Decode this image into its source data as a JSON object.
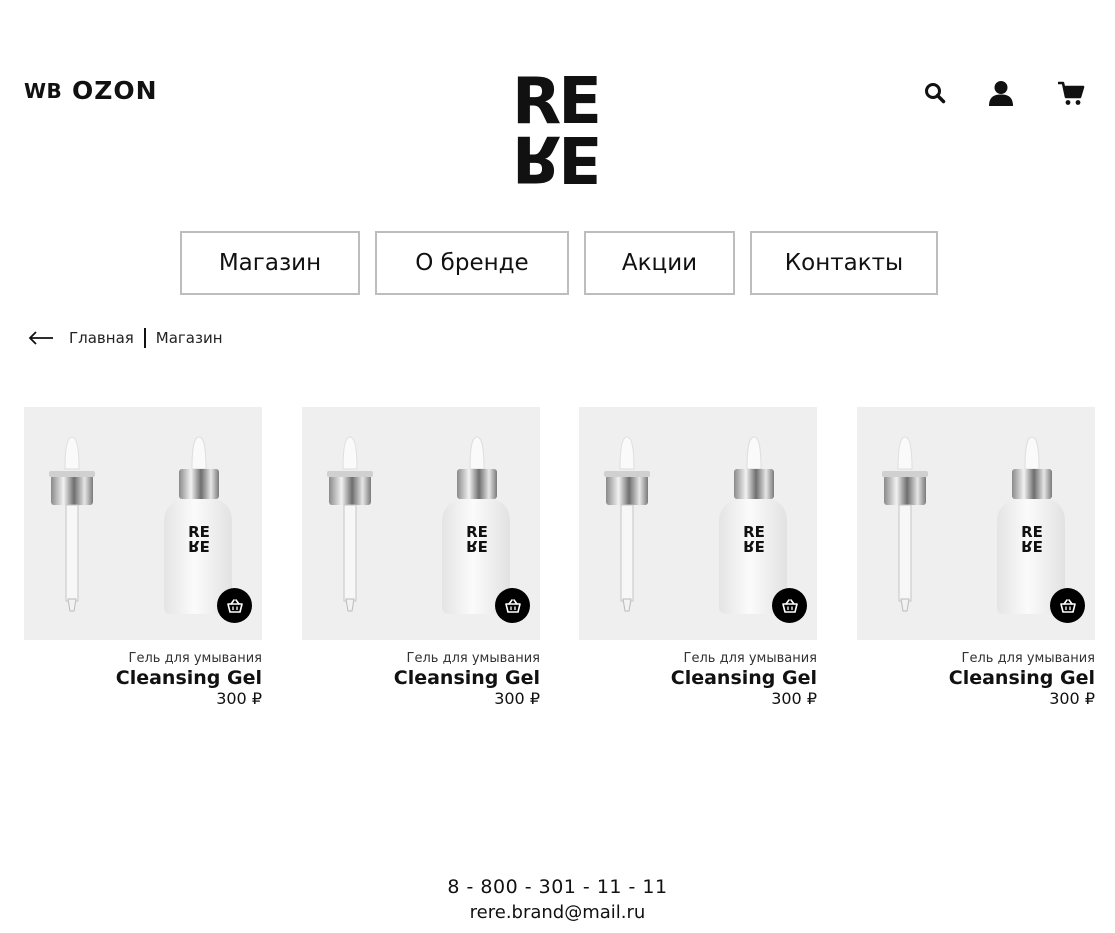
{
  "header": {
    "marketplaces": [
      "WB",
      "OZON"
    ],
    "logo_top": "RE",
    "logo_bottom": "RE",
    "icons": [
      "search-icon",
      "user-icon",
      "cart-icon"
    ]
  },
  "nav": {
    "items": [
      "Магазин",
      "О бренде",
      "Акции",
      "Контакты"
    ]
  },
  "breadcrumb": {
    "items": [
      "Главная",
      "Магазин"
    ]
  },
  "products": [
    {
      "category": "Гель для умывания",
      "name": "Cleansing Gel",
      "price": "300 ₽",
      "bottle_label_top": "RE",
      "bottle_label_bottom": "RE"
    },
    {
      "category": "Гель для умывания",
      "name": "Cleansing Gel",
      "price": "300 ₽",
      "bottle_label_top": "RE",
      "bottle_label_bottom": "RE"
    },
    {
      "category": "Гель для умывания",
      "name": "Cleansing Gel",
      "price": "300 ₽",
      "bottle_label_top": "RE",
      "bottle_label_bottom": "RE"
    },
    {
      "category": "Гель для умывания",
      "name": "Cleansing Gel",
      "price": "300 ₽",
      "bottle_label_top": "RE",
      "bottle_label_bottom": "RE"
    }
  ],
  "footer": {
    "phone": "8 - 800 - 301 - 11 - 11",
    "email": "rere.brand@mail.ru"
  },
  "colors": {
    "text": "#111111",
    "product_bg": "#efefef",
    "nav_border": "#bdbdbd",
    "cart_button": "#000000"
  }
}
